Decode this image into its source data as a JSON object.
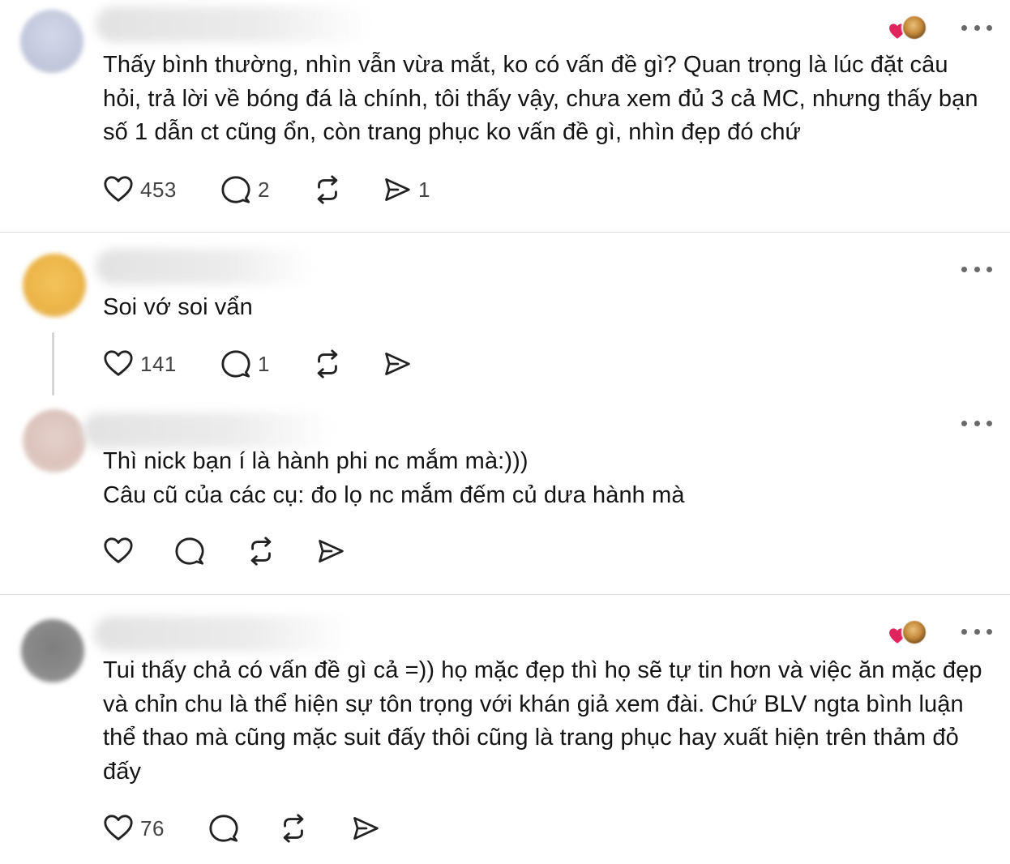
{
  "icons": {
    "like": "heart-icon",
    "reply": "comment-bubble-icon",
    "repost": "repost-arrows-icon",
    "share": "send-paper-plane-icon",
    "more": "more-dots-icon"
  },
  "colors": {
    "text": "#141414",
    "muted": "#444444",
    "divider": "#dcdcdc",
    "heart_react": "#e0245e"
  },
  "posts": [
    {
      "text": "Thấy bình thường, nhìn vẫn vừa mắt, ko có vấn đề gì? Quan trọng là lúc đặt câu hỏi, trả lời về bóng đá là chính, tôi thấy vậy, chưa xem đủ 3 cả MC, nhưng thấy bạn số 1 dẫn ct cũng ổn, còn trang phục ko vấn đề gì, nhìn đẹp đó chứ",
      "likes": "453",
      "replies": "2",
      "shares": "1"
    },
    {
      "text": "Soi vớ soi vẩn",
      "likes": "141",
      "replies": "1"
    },
    {
      "text": "Thì nick bạn í là hành phi nc mắm mà:)))\nCâu cũ của các cụ: đo lọ nc mắm đếm củ dưa hành mà"
    },
    {
      "text": "Tui thấy chả có vấn đề gì cả =)) họ mặc đẹp thì họ sẽ tự tin hơn và việc ăn mặc đẹp và chỉn chu là thể hiện sự tôn trọng với khán giả xem đài. Chứ BLV ngta bình luận thể thao mà cũng mặc suit đấy thôi cũng là trang phục hay xuất hiện trên thảm đỏ đấy",
      "likes": "76"
    }
  ]
}
